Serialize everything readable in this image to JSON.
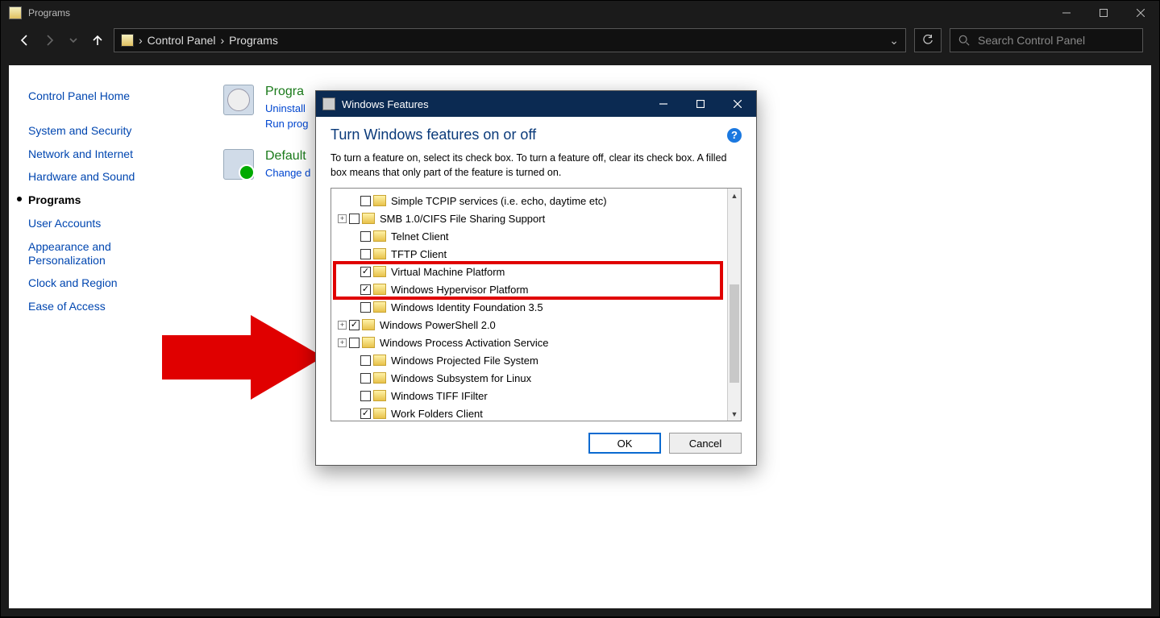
{
  "window": {
    "title": "Programs",
    "search_placeholder": "Search Control Panel"
  },
  "breadcrumb": {
    "root": "Control Panel",
    "current": "Programs"
  },
  "sidebar": {
    "items": [
      {
        "label": "Control Panel Home",
        "active": false
      },
      {
        "label": "System and Security",
        "active": false
      },
      {
        "label": "Network and Internet",
        "active": false
      },
      {
        "label": "Hardware and Sound",
        "active": false
      },
      {
        "label": "Programs",
        "active": true
      },
      {
        "label": "User Accounts",
        "active": false
      },
      {
        "label": "Appearance and Personalization",
        "active": false
      },
      {
        "label": "Clock and Region",
        "active": false
      },
      {
        "label": "Ease of Access",
        "active": false
      }
    ]
  },
  "main": {
    "cat1_title": "Progra",
    "cat1_sub1": "Uninstall",
    "cat1_sub2": "Run prog",
    "cat2_title": "Default",
    "cat2_sub1": "Change d"
  },
  "dialog": {
    "title": "Windows Features",
    "heading": "Turn Windows features on or off",
    "description": "To turn a feature on, select its check box. To turn a feature off, clear its check box. A filled box means that only part of the feature is turned on.",
    "ok": "OK",
    "cancel": "Cancel",
    "features": [
      {
        "label": "Simple TCPIP services (i.e. echo, daytime etc)",
        "checked": false,
        "expander": ""
      },
      {
        "label": "SMB 1.0/CIFS File Sharing Support",
        "checked": false,
        "expander": "+"
      },
      {
        "label": "Telnet Client",
        "checked": false,
        "expander": ""
      },
      {
        "label": "TFTP Client",
        "checked": false,
        "expander": ""
      },
      {
        "label": "Virtual Machine Platform",
        "checked": true,
        "expander": ""
      },
      {
        "label": "Windows Hypervisor Platform",
        "checked": true,
        "expander": ""
      },
      {
        "label": "Windows Identity Foundation 3.5",
        "checked": false,
        "expander": ""
      },
      {
        "label": "Windows PowerShell 2.0",
        "checked": true,
        "expander": "+"
      },
      {
        "label": "Windows Process Activation Service",
        "checked": false,
        "expander": "+"
      },
      {
        "label": "Windows Projected File System",
        "checked": false,
        "expander": ""
      },
      {
        "label": "Windows Subsystem for Linux",
        "checked": false,
        "expander": ""
      },
      {
        "label": "Windows TIFF IFilter",
        "checked": false,
        "expander": ""
      },
      {
        "label": "Work Folders Client",
        "checked": true,
        "expander": ""
      }
    ],
    "highlight_rows": [
      4,
      5
    ]
  }
}
